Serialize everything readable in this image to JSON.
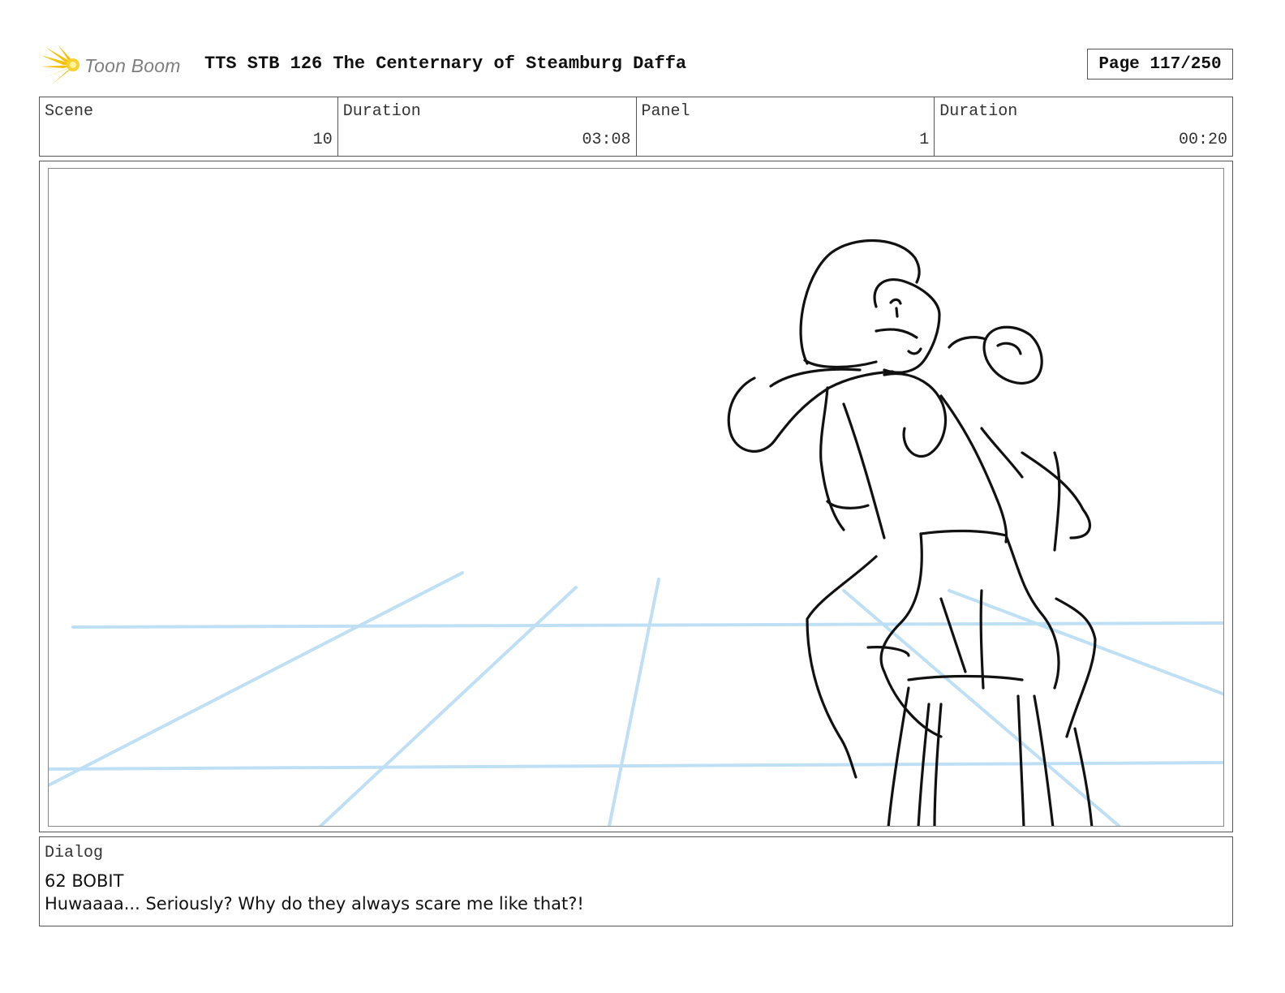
{
  "header": {
    "logo_text": "Toon Boom",
    "title": "TTS STB 126 The Centernary of Steamburg Daffa",
    "page": "Page 117/250"
  },
  "info": {
    "scene_label": "Scene",
    "scene_value": "10",
    "scene_duration_label": "Duration",
    "scene_duration_value": "03:08",
    "panel_label": "Panel",
    "panel_value": "1",
    "panel_duration_label": "Duration",
    "panel_duration_value": "00:20"
  },
  "dialog": {
    "label": "Dialog",
    "speaker": "62 BOBIT",
    "line": "Huwaaaa... Seriously? Why do they always scare me like that?!"
  },
  "colors": {
    "guide_lines": "#bfe0f4",
    "sketch": "#111111",
    "logo_burst": "#f4c20d",
    "logo_text": "#7f7f7f"
  }
}
